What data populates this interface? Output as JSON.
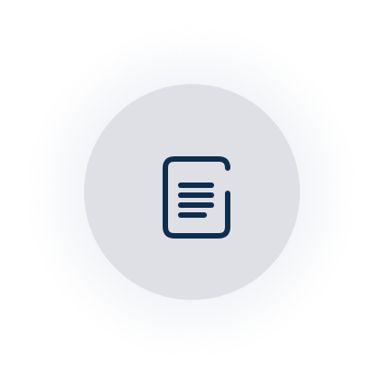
{
  "button": {
    "icon": "document-lines-icon",
    "background_color": "#dfe0e5",
    "icon_color": "#0f2d4f"
  }
}
